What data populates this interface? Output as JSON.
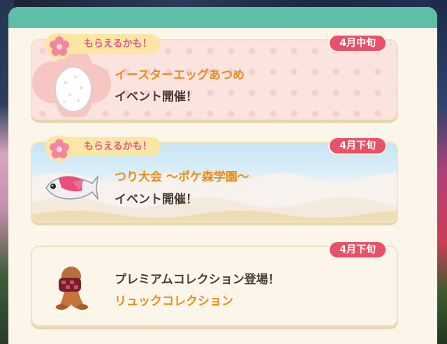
{
  "events": [
    {
      "tag": "もらえるかも！",
      "date": "4月中旬",
      "title": "イースターエッグあつめ",
      "subtitle": "イベント開催！",
      "icon": "easter-egg-icon"
    },
    {
      "tag": "もらえるかも！",
      "date": "4月下旬",
      "title": "つり大会 〜ポケ森学園〜",
      "subtitle": "イベント開催！",
      "icon": "fish-icon"
    },
    {
      "date": "4月下旬",
      "subtitle": "プレミアムコレクション登場！",
      "title": "リュックコレクション",
      "icon": "backpack-icon"
    }
  ],
  "colors": {
    "header": "#5dbfa8",
    "badge": "#e85268",
    "title": "#ee8c17",
    "tag_text": "#e25a8a",
    "tag_bg": "#fbe6a4"
  }
}
